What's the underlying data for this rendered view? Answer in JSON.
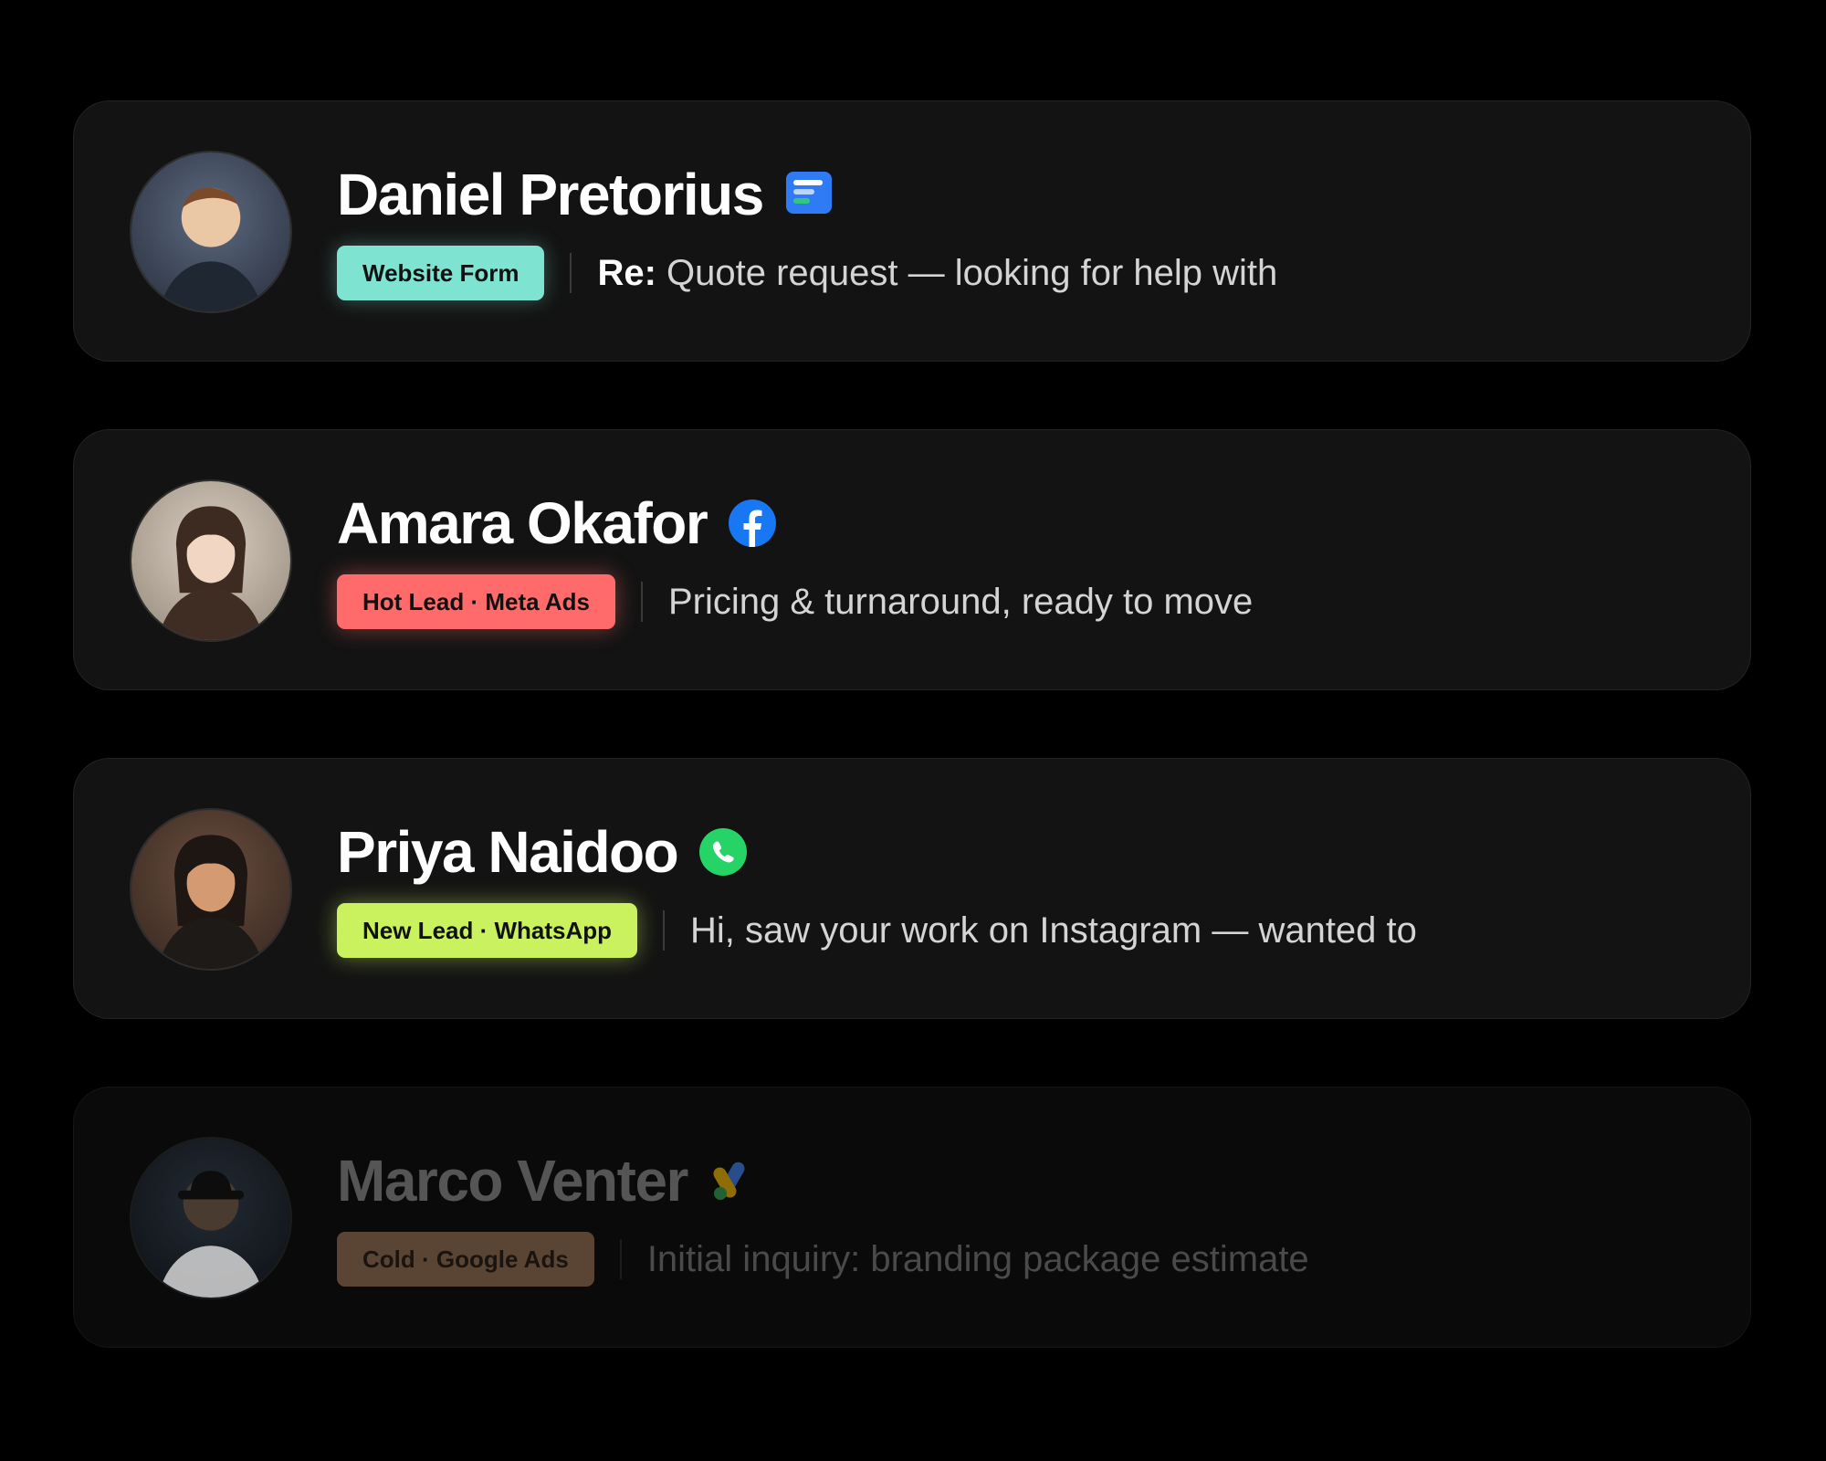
{
  "leads": [
    {
      "name": "Daniel Pretorius",
      "source_icon": "form-icon",
      "badge": "Website Form",
      "badge_color": "#7fe3d2",
      "message_prefix": "Re:",
      "message": " Quote request — looking for help with"
    },
    {
      "name": "Amara Okafor",
      "source_icon": "facebook-icon",
      "badge": "Hot Lead · Meta Ads",
      "badge_color": "#ff6b6b",
      "message": "Pricing & turnaround, ready to move"
    },
    {
      "name": "Priya Naidoo",
      "source_icon": "whatsapp-icon",
      "badge": "New Lead · WhatsApp",
      "badge_color": "#c9f25e",
      "message": "Hi, saw your work on Instagram — wanted to"
    },
    {
      "name": "Marco Venter",
      "source_icon": "google-ads-icon",
      "badge": "Cold · Google Ads",
      "badge_color": "#5a4534",
      "message": "Initial inquiry: branding package estimate"
    }
  ]
}
